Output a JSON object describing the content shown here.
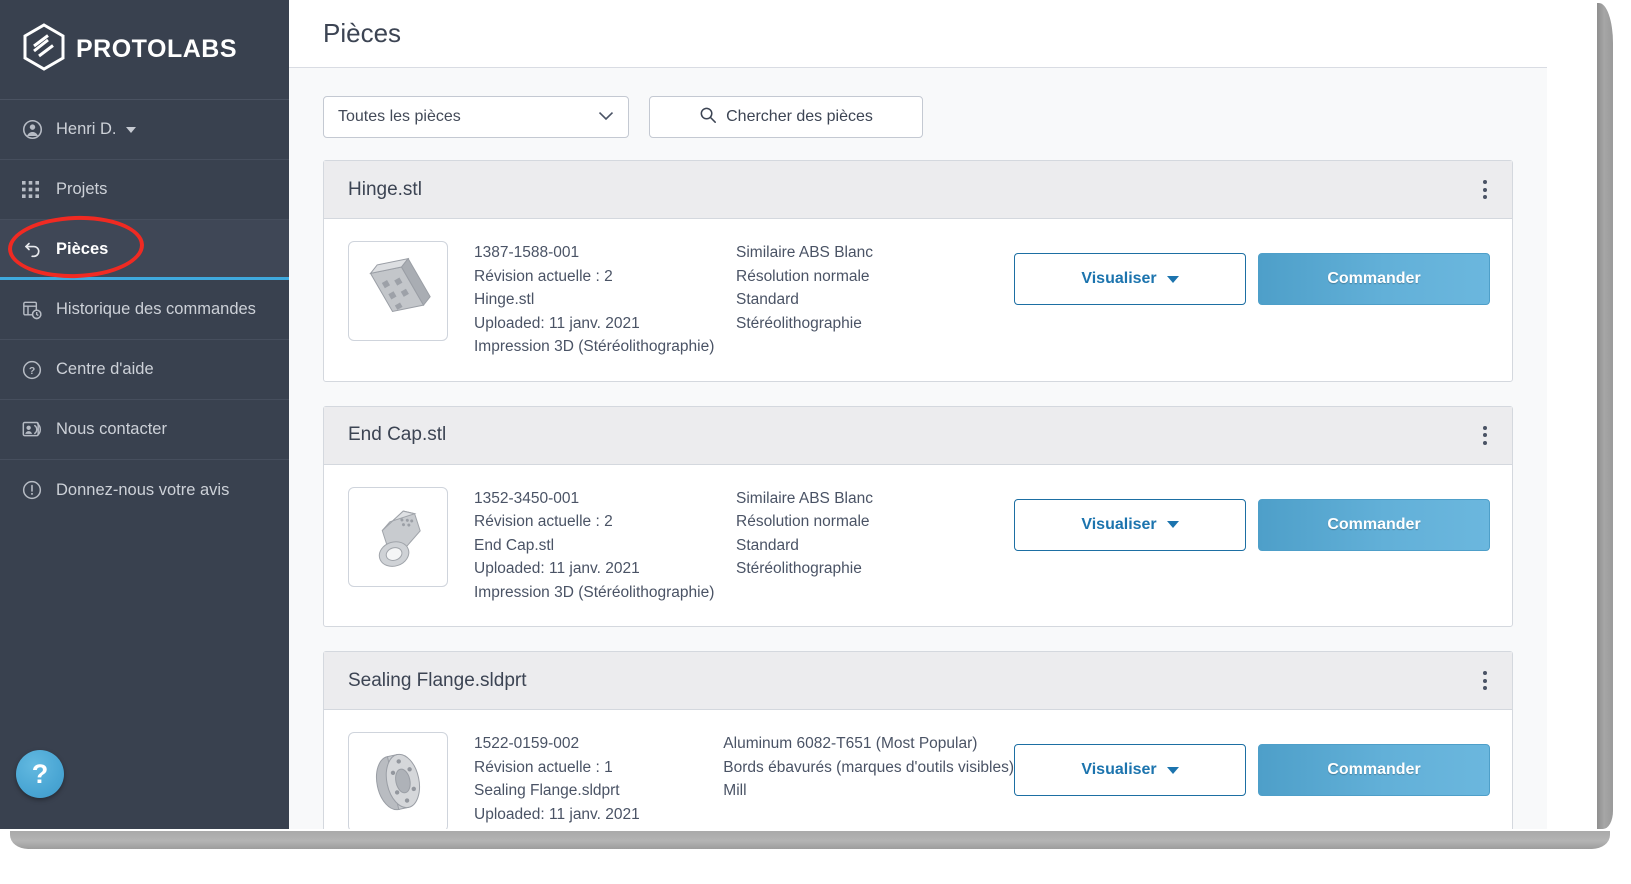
{
  "sidebar": {
    "brand": {
      "name": "PROTOLABS",
      "logo_icon": "protolabs-hexagon-logo"
    },
    "user": {
      "label": "Henri D.",
      "icon": "user-circle-icon"
    },
    "items": [
      {
        "label": "Projets",
        "icon": "grid-apps-icon",
        "active": false
      },
      {
        "label": "Pièces",
        "icon": "undo-arrow-icon",
        "active": true
      },
      {
        "label": "Historique des commandes",
        "icon": "order-history-icon",
        "active": false
      },
      {
        "label": "Centre d'aide",
        "icon": "question-circle-icon",
        "active": false
      },
      {
        "label": "Nous contacter",
        "icon": "contact-card-icon",
        "active": false
      },
      {
        "label": "Donnez-nous votre avis",
        "icon": "exclamation-circle-icon",
        "active": false
      }
    ],
    "help_fab": {
      "label": "?",
      "icon": "help-question-icon"
    },
    "active_accent_color": "#3fa9dd",
    "background_color": "#39414f"
  },
  "header": {
    "title": "Pièces"
  },
  "toolbar": {
    "filter": {
      "selected": "Toutes les pièces",
      "icon": "chevron-down-icon"
    },
    "search": {
      "label": "Chercher des pièces",
      "icon": "search-icon"
    }
  },
  "annotation": {
    "shape": "ellipse",
    "color": "#f02a22",
    "target": "sidebar-item-pieces"
  },
  "cards": [
    {
      "title": "Hinge.stl",
      "thumbnail_icon": "hinge-3d-model-thumb",
      "menu_icon": "kebab-menu-icon",
      "spec_left": [
        "1387-1588-001",
        "Révision actuelle : 2",
        "Hinge.stl",
        "Uploaded: 11 janv. 2021",
        "Impression 3D (Stéréolithographie)"
      ],
      "spec_right": [
        "Similaire ABS Blanc",
        "Résolution normale",
        "Standard",
        "Stéréolithographie"
      ],
      "view_button": "Visualiser",
      "order_button": "Commander"
    },
    {
      "title": "End Cap.stl",
      "thumbnail_icon": "end-cap-3d-model-thumb",
      "menu_icon": "kebab-menu-icon",
      "spec_left": [
        "1352-3450-001",
        "Révision actuelle : 2",
        "End Cap.stl",
        "Uploaded: 11 janv. 2021",
        "Impression 3D (Stéréolithographie)"
      ],
      "spec_right": [
        "Similaire ABS Blanc",
        "Résolution normale",
        "Standard",
        "Stéréolithographie"
      ],
      "view_button": "Visualiser",
      "order_button": "Commander"
    },
    {
      "title": "Sealing Flange.sldprt",
      "thumbnail_icon": "sealing-flange-3d-model-thumb",
      "menu_icon": "kebab-menu-icon",
      "spec_left": [
        "1522-0159-002",
        "Révision actuelle : 1",
        "Sealing Flange.sldprt",
        "Uploaded: 11 janv. 2021"
      ],
      "spec_right": [
        "Aluminum 6082-T651 (Most Popular)",
        "Bords ébavurés (marques d'outils visibles)",
        "Mill"
      ],
      "view_button": "Visualiser",
      "order_button": "Commander"
    }
  ]
}
